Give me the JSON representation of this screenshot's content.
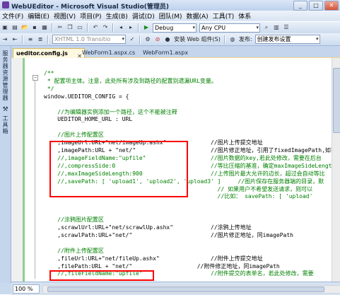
{
  "window": {
    "title": "WebUEditor - Microsoft Visual Studio(管理员)"
  },
  "menu": [
    "文件(F)",
    "编辑(E)",
    "视图(V)",
    "项目(P)",
    "生成(B)",
    "调试(D)",
    "团队(M)",
    "数据(A)",
    "工具(T)",
    "体系"
  ],
  "toolbar": {
    "config": "Debug",
    "platform": "Any CPU",
    "doctype": "XHTML 1.0 Transitio",
    "install_label": "安装 Web 组件(S)",
    "publish_label": "发布:",
    "publish_value": "创建发布设置"
  },
  "left_strip": {
    "server_explorer": "服务器资源管理器",
    "toolbox": "工具箱"
  },
  "tabs": [
    "ueditor.config.js",
    "WebForm1.aspx.cs",
    "WebForm1.aspx"
  ],
  "code_lines": [
    {
      "t": "/**",
      "c": "green"
    },
    {
      "t": " * 配置项主体。注意，此处所有涉及到路径的配置别遗漏URL变量。",
      "c": "green"
    },
    {
      "t": " */",
      "c": "green"
    },
    {
      "t": "window.UEDITOR_CONFIG = {",
      "c": "black"
    },
    {
      "t": "",
      "c": "black"
    },
    {
      "t": "    //为编辑器实例添加一个路径，这个不能被注释",
      "c": "green"
    },
    {
      "t": "    UEDITOR_HOME_URL : URL",
      "c": "black"
    },
    {
      "t": "",
      "c": "black"
    },
    {
      "t": "    //图片上传配置区",
      "c": "green"
    },
    {
      "t": "    ,imageUrl:URL+\"net/imageUp.ashx\"             //图片上传提交地址",
      "c": "black"
    },
    {
      "t": "    ,imagePath:URL + \"net/\"                      //图片修正地址，引用了fixedImagePath,如有",
      "c": "black"
    },
    {
      "t": "    //,imageFieldName:\"upfile\"                   //图片数据的key,若此处修改，需要在后台",
      "c": "green"
    },
    {
      "t": "    //,compressSide:0                            //等比压缩的基准，确定maxImageSideLength参",
      "c": "green"
    },
    {
      "t": "    //,maxImageSideLength:900                    //上传图片最大允许的边长，超过会自动等比",
      "c": "green"
    },
    {
      "t": "    //,savePath: [ 'upload1', 'upload2', 'upload3' ]     //图片保存在服务器端的目录，默",
      "c": "green"
    },
    {
      "t": "                                                   // 如果用户不希望发送请求，则可以",
      "c": "green"
    },
    {
      "t": "                                                   //比如： savePath: [ 'upload'",
      "c": "green"
    },
    {
      "t": "",
      "c": "black"
    },
    {
      "t": "",
      "c": "black"
    },
    {
      "t": "    //涂鸦图片配置区",
      "c": "green"
    },
    {
      "t": "    ,scrawlUrl:URL+\"net/scrawlUp.ashx\"           //涂鸦上传地址",
      "c": "black"
    },
    {
      "t": "    ,scrawlPath:URL+\"net/\"                       //图片修正地址，同imagePath",
      "c": "black"
    },
    {
      "t": "",
      "c": "black"
    },
    {
      "t": "    //附件上传配置区",
      "c": "green"
    },
    {
      "t": "    ,fileUrl:URL+\"net/fileUp.ashx\"               //附件上传提交地址",
      "c": "black"
    },
    {
      "t": "    ,filePath:URL + \"net/\"                   //附件修正地址，同imagePath",
      "c": "black"
    },
    {
      "t": "    //,fileFieldName:\"upfile\"                    //附件提交的表单名，若此处修改，需要",
      "c": "green"
    }
  ],
  "status": {
    "zoom": "100 %"
  }
}
